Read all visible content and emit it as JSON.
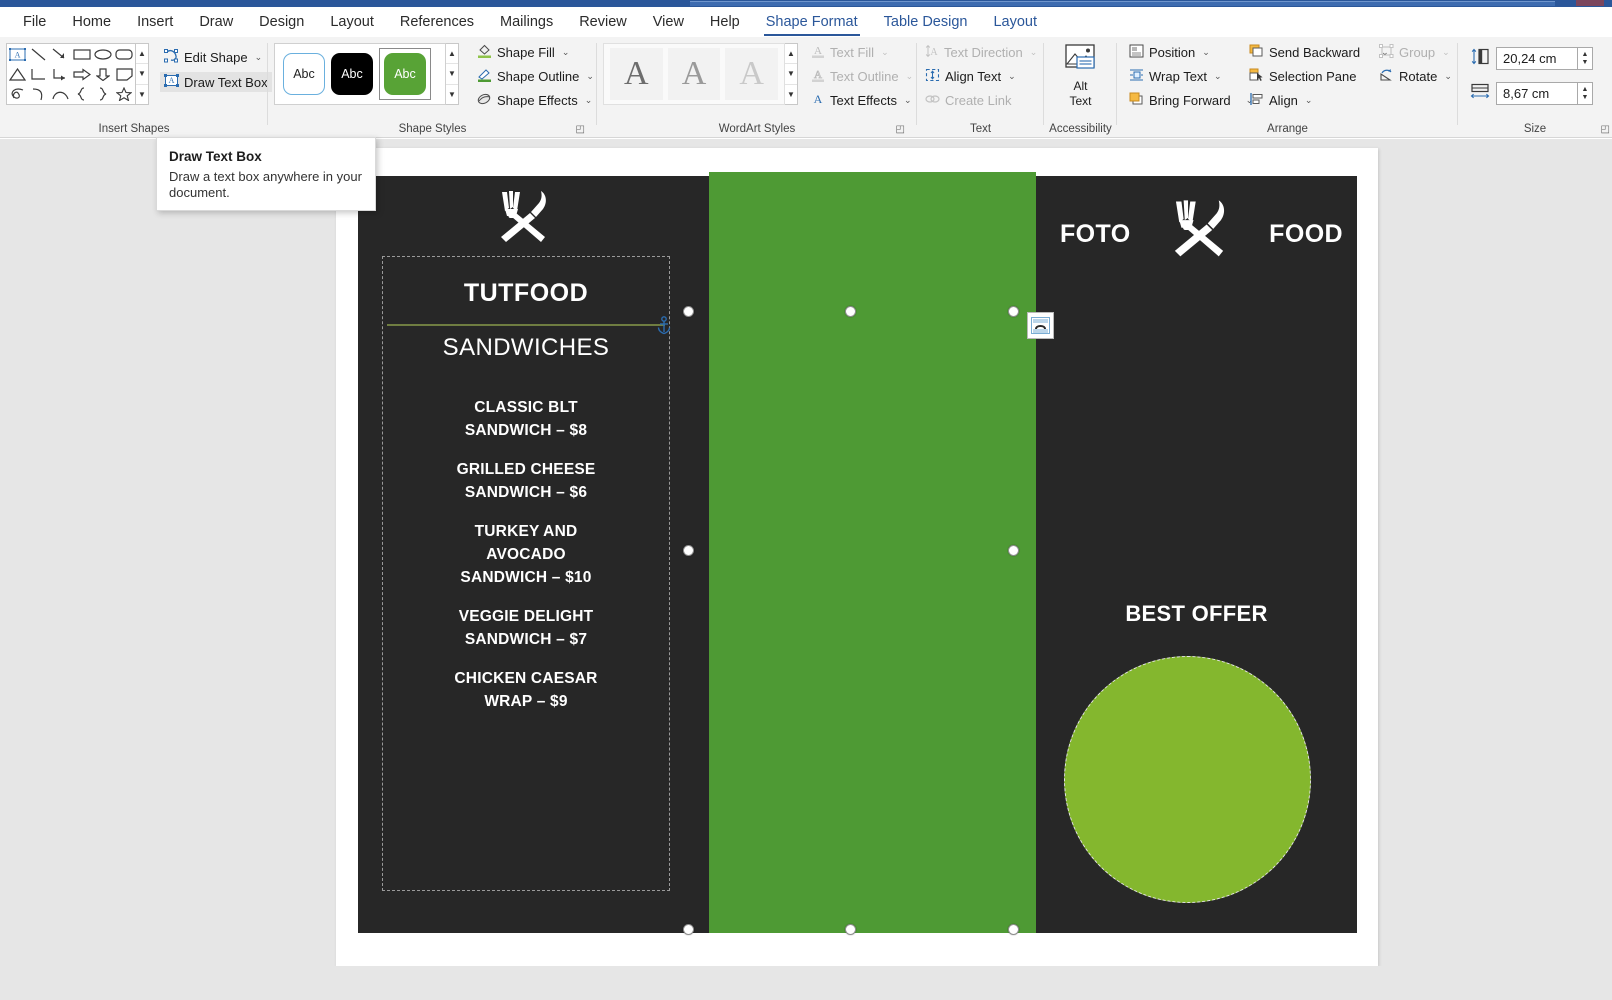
{
  "app": {
    "title_bar_color": "#2b579a"
  },
  "tabs": [
    {
      "label": "File",
      "state": "normal"
    },
    {
      "label": "Home",
      "state": "normal"
    },
    {
      "label": "Insert",
      "state": "normal"
    },
    {
      "label": "Draw",
      "state": "normal"
    },
    {
      "label": "Design",
      "state": "normal"
    },
    {
      "label": "Layout",
      "state": "normal"
    },
    {
      "label": "References",
      "state": "normal"
    },
    {
      "label": "Mailings",
      "state": "normal"
    },
    {
      "label": "Review",
      "state": "normal"
    },
    {
      "label": "View",
      "state": "normal"
    },
    {
      "label": "Help",
      "state": "normal"
    },
    {
      "label": "Shape Format",
      "state": "active"
    },
    {
      "label": "Table Design",
      "state": "contextual"
    },
    {
      "label": "Layout",
      "state": "contextual"
    }
  ],
  "ribbon": {
    "groups": [
      {
        "name": "insert_shapes",
        "label": "Insert Shapes"
      },
      {
        "name": "shape_styles",
        "label": "Shape Styles"
      },
      {
        "name": "wordart_styles",
        "label": "WordArt Styles"
      },
      {
        "name": "text",
        "label": "Text"
      },
      {
        "name": "accessibility",
        "label": "Accessibility"
      },
      {
        "name": "arrange",
        "label": "Arrange"
      },
      {
        "name": "size",
        "label": "Size"
      }
    ],
    "insert_shapes": {
      "shape_icons": [
        "text-box-shape",
        "line-shape",
        "line-arrow-shape",
        "rectangle-shape",
        "oval-shape",
        "rounded-rectangle-shape",
        "triangle-shape",
        "elbow-connector-shape",
        "elbow-arrow-connector-shape",
        "right-arrow-shape",
        "down-arrow-shape",
        "folded-corner-shape",
        "scribble-shape",
        "curve-shape",
        "arc-shape",
        "left-brace-shape",
        "right-brace-shape",
        "star-shape"
      ],
      "edit_shape": "Edit Shape",
      "draw_text_box": "Draw Text Box"
    },
    "shape_styles": {
      "thumbs": [
        {
          "label": "Abc",
          "style": "outline-light"
        },
        {
          "label": "Abc",
          "style": "filled-black"
        },
        {
          "label": "Abc",
          "style": "filled-green",
          "selected": true
        }
      ],
      "shape_fill": "Shape Fill",
      "shape_outline": "Shape Outline",
      "shape_effects": "Shape Effects"
    },
    "wordart_styles": {
      "thumbs": [
        "A",
        "A",
        "A"
      ],
      "text_fill": "Text Fill",
      "text_outline": "Text Outline",
      "text_effects": "Text Effects"
    },
    "text_group": {
      "text_direction": "Text Direction",
      "align_text": "Align Text",
      "create_link": "Create Link"
    },
    "accessibility": {
      "alt_text_line1": "Alt",
      "alt_text_line2": "Text"
    },
    "arrange": {
      "position": "Position",
      "wrap_text": "Wrap Text",
      "bring_forward": "Bring Forward",
      "send_backward": "Send Backward",
      "selection_pane": "Selection Pane",
      "align": "Align",
      "group": "Group",
      "rotate": "Rotate"
    },
    "size": {
      "height_value": "20,24 cm",
      "width_value": "8,67 cm"
    }
  },
  "tooltip": {
    "title": "Draw Text Box",
    "body": "Draw a text box anywhere in your document."
  },
  "document": {
    "menu": {
      "brand": "TUTFOOD",
      "section_title": "SANDWICHES",
      "items": [
        "CLASSIC BLT\nSANDWICH – $8",
        "GRILLED CHEESE\nSANDWICH – $6",
        "TURKEY AND\nAVOCADO\nSANDWICH – $10",
        "VEGGIE DELIGHT\nSANDWICH – $7",
        "CHICKEN CAESAR\nWRAP – $9"
      ],
      "right_panel": {
        "foto": "FOTO",
        "food": "FOOD",
        "best_offer": "BEST OFFER"
      },
      "colors": {
        "background": "#272727",
        "selected_shape": "#4e9a34",
        "circle": "#84b72e",
        "rule": "#6f7d41"
      }
    }
  }
}
